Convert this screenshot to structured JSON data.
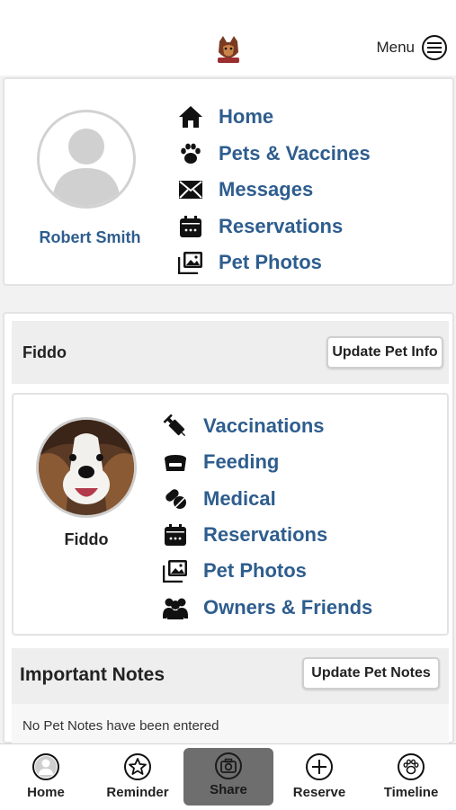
{
  "header": {
    "menu_label": "Menu"
  },
  "owner": {
    "name": "Robert Smith",
    "nav": [
      {
        "label": "Home",
        "icon": "house-icon"
      },
      {
        "label": "Pets & Vaccines",
        "icon": "paw-icon"
      },
      {
        "label": "Messages",
        "icon": "envelope-icon"
      },
      {
        "label": "Reservations",
        "icon": "calendar-icon"
      },
      {
        "label": "Pet Photos",
        "icon": "photos-icon"
      }
    ]
  },
  "pet": {
    "header_name": "Fiddo",
    "update_info_label": "Update Pet Info",
    "name": "Fiddo",
    "nav": [
      {
        "label": "Vaccinations",
        "icon": "syringe-icon"
      },
      {
        "label": "Feeding",
        "icon": "food-bowl-icon"
      },
      {
        "label": "Medical",
        "icon": "pills-icon"
      },
      {
        "label": "Reservations",
        "icon": "calendar-icon"
      },
      {
        "label": "Pet Photos",
        "icon": "photos-icon"
      },
      {
        "label": "Owners & Friends",
        "icon": "people-icon"
      }
    ]
  },
  "notes": {
    "title": "Important Notes",
    "update_label": "Update Pet Notes",
    "empty_text": "No Pet Notes have been entered"
  },
  "bottom_nav": {
    "tabs": [
      {
        "label": "Home",
        "icon": "user-circle-icon"
      },
      {
        "label": "Reminder",
        "icon": "star-icon"
      },
      {
        "label": "Share",
        "icon": "camera-icon",
        "active": true
      },
      {
        "label": "Reserve",
        "icon": "plus-circle-icon"
      },
      {
        "label": "Timeline",
        "icon": "paw-circle-icon"
      }
    ]
  },
  "colors": {
    "link": "#2e5d8e",
    "active_tab_bg": "#6e6e6e",
    "panel_bg": "#eeeeee"
  }
}
